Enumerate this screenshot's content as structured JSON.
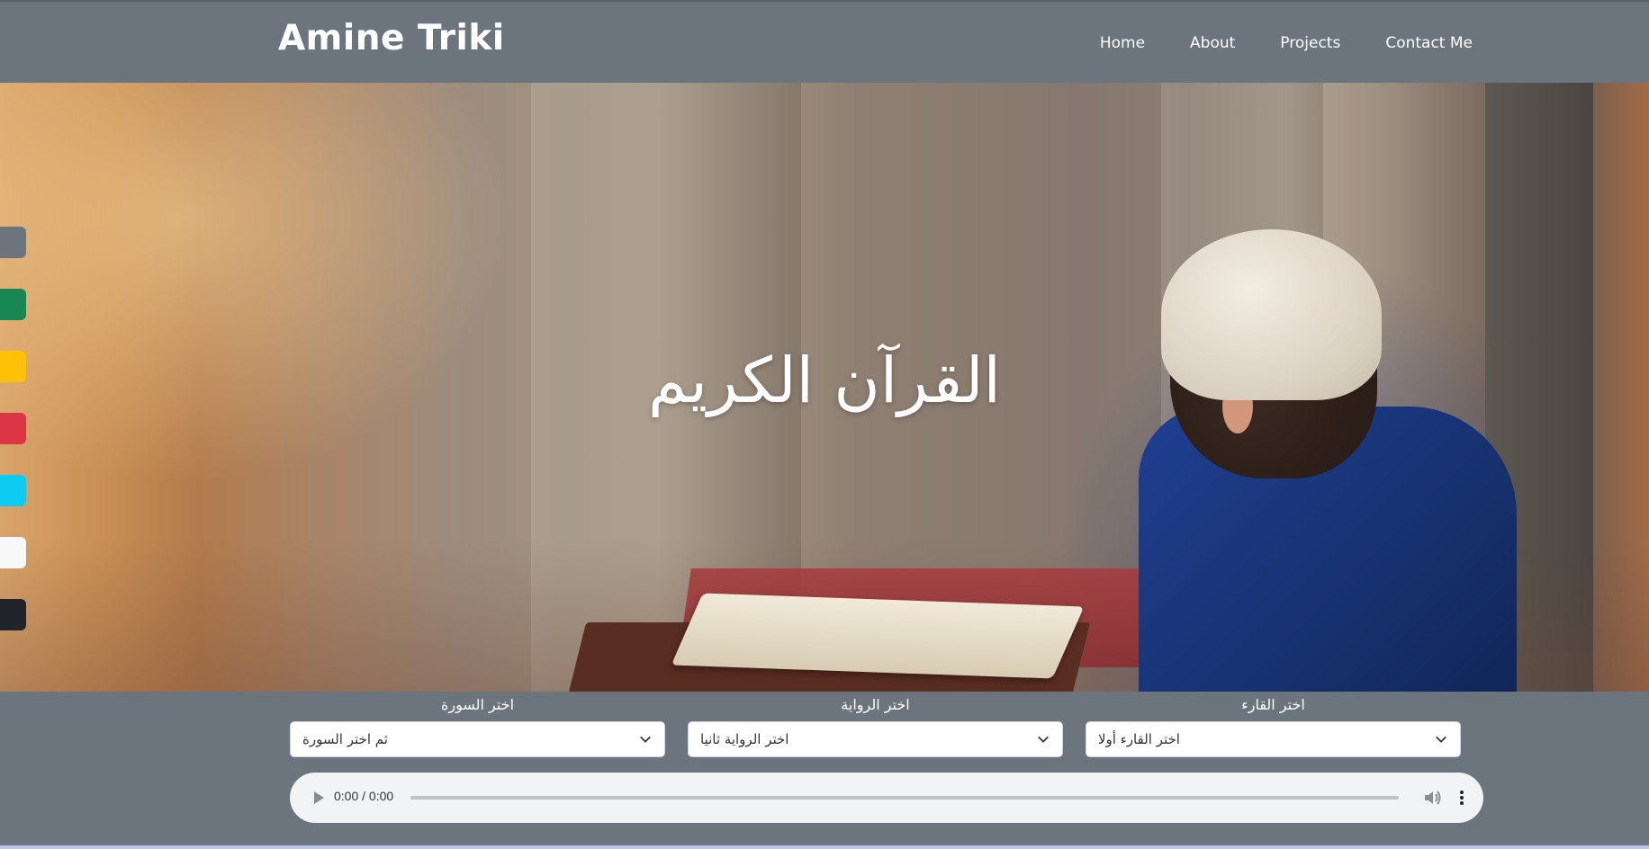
{
  "header": {
    "brand": "Amine Triki",
    "nav": [
      "Home",
      "About",
      "Projects",
      "Contact Me"
    ]
  },
  "hero": {
    "title": "القرآن الكريم"
  },
  "color_switcher": {
    "colors": [
      "#6c757d",
      "#198754",
      "#ffc107",
      "#dc3545",
      "#0dcaf0",
      "#f8f9fa",
      "#212529"
    ]
  },
  "controls": {
    "sura": {
      "label": "اختر السورة",
      "value": "ثم اختر السورة"
    },
    "riwaya": {
      "label": "اختر الرواية",
      "value": "اختر الرواية ثانيا"
    },
    "qari": {
      "label": "اختر القارء",
      "value": "اختر القارء أولا"
    }
  },
  "audio": {
    "time": "0:00 / 0:00"
  },
  "colors": {
    "header_bg": "#6c757d",
    "audio_bg": "#f1f3f4"
  }
}
